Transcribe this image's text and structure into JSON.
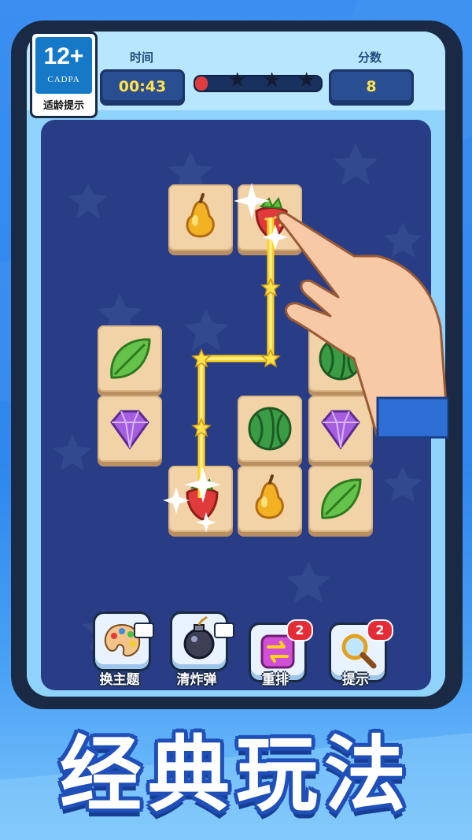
{
  "age_rating": {
    "number": "12+",
    "org": "CADPA",
    "label": "适龄提示"
  },
  "header": {
    "time_label": "时间",
    "time_value": "00:43",
    "score_label": "分数",
    "score_value": "8",
    "progress_fraction": 0.1,
    "stars_earned": 0,
    "stars_total": 3
  },
  "board": {
    "tiles": [
      "pear",
      "strawberry",
      "leaf",
      "watermelon",
      "gem",
      "watermelon",
      "gem",
      "strawberry",
      "pear",
      "leaf"
    ]
  },
  "tools": [
    {
      "label": "换主题",
      "icon": "palette-icon",
      "badge": "",
      "video": true
    },
    {
      "label": "清炸弹",
      "icon": "bomb-icon",
      "badge": "",
      "video": true
    },
    {
      "label": "重排",
      "icon": "shuffle-icon",
      "badge": "2",
      "video": false
    },
    {
      "label": "提示",
      "icon": "magnifier-icon",
      "badge": "2",
      "video": false
    }
  ],
  "banner": {
    "title": "经典玩法"
  },
  "colors": {
    "background": "#3a8ff0",
    "board": "#283d86",
    "tile": "#f2d3a7",
    "accent": "#ffe63a",
    "badge": "#e52c36"
  }
}
